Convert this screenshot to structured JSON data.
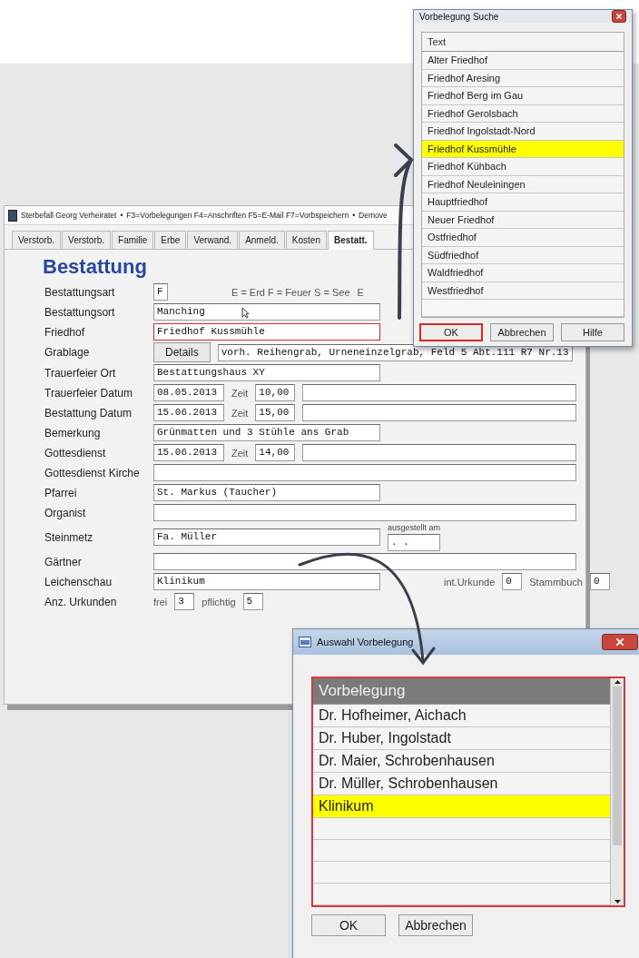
{
  "main_window": {
    "title": "Sterbefall Georg Verheiratet",
    "title_parts": [
      "•",
      "F3=Vorbelegungen F4=Anschriften F5=E-Mail F7=Vorbspeichern",
      "•",
      "Demove"
    ],
    "tabs": [
      {
        "label": "Verstorb.",
        "selected": false
      },
      {
        "label": "Verstorb.",
        "selected": false
      },
      {
        "label": "Familie",
        "selected": false
      },
      {
        "label": "Erbe",
        "selected": false
      },
      {
        "label": "Verwand.",
        "selected": false
      },
      {
        "label": "Anmeld.",
        "selected": false
      },
      {
        "label": "Kosten",
        "selected": false
      },
      {
        "label": "Bestatt.",
        "selected": true
      }
    ],
    "heading": "Bestattung",
    "rows": [
      {
        "label": "Bestattungsart",
        "items": [
          {
            "kind": "code",
            "value": "F"
          },
          {
            "kind": "note",
            "text": "E = Erd  F = Feuer  S = See"
          },
          {
            "kind": "note",
            "text": "E"
          }
        ]
      },
      {
        "label": "Bestattungsort",
        "items": [
          {
            "kind": "field",
            "value": "Manching",
            "mouse_pointer": true
          }
        ]
      },
      {
        "label": "Friedhof",
        "items": [
          {
            "kind": "field",
            "value": "Friedhof Kussmühle",
            "highlighted": true
          }
        ]
      },
      {
        "label": "Grablage",
        "items": [
          {
            "kind": "button",
            "text": "Details"
          },
          {
            "kind": "field",
            "value": "vorh. Reihengrab, Urneneinzelgrab, Feld 5 Abt.111 R7 Nr.13"
          }
        ]
      },
      {
        "label": "Trauerfeier  Ort",
        "items": [
          {
            "kind": "field",
            "value": "Bestattungshaus XY"
          }
        ]
      },
      {
        "label": "Trauerfeier Datum",
        "items": [
          {
            "kind": "date",
            "value": "08.05.2013"
          },
          {
            "kind": "note",
            "text": "Zeit"
          },
          {
            "kind": "time",
            "value": "10,00"
          },
          {
            "kind": "blank"
          }
        ]
      },
      {
        "label": "Bestattung Datum",
        "items": [
          {
            "kind": "date",
            "value": "15.06.2013"
          },
          {
            "kind": "note",
            "text": "Zeit"
          },
          {
            "kind": "time",
            "value": "15,00"
          },
          {
            "kind": "blank"
          }
        ]
      },
      {
        "label": "Bemerkung",
        "items": [
          {
            "kind": "field",
            "value": "Grünmatten und 3 Stühle ans Grab"
          }
        ]
      },
      {
        "label": "Gottesdienst",
        "items": [
          {
            "kind": "date",
            "value": "15.06.2013"
          },
          {
            "kind": "note",
            "text": "Zeit"
          },
          {
            "kind": "time",
            "value": "14,00"
          },
          {
            "kind": "blank"
          }
        ]
      },
      {
        "label": "Gottesdienst Kirche",
        "items": [
          {
            "kind": "blank"
          }
        ]
      },
      {
        "label": "Pfarrei",
        "items": [
          {
            "kind": "field",
            "value": "St. Markus (Taucher)"
          }
        ]
      },
      {
        "label": "Organist",
        "items": [
          {
            "kind": "blank"
          }
        ]
      },
      {
        "label": "Steinmetz",
        "items": [
          {
            "kind": "field",
            "value": "Fa. Müller"
          },
          {
            "kind": "captioned",
            "caption": "ausgestellt am",
            "value": ".  ."
          }
        ]
      },
      {
        "label": "Gärtner",
        "items": [
          {
            "kind": "blank"
          }
        ]
      },
      {
        "label": "Leichenschau",
        "items": [
          {
            "kind": "field",
            "value": "Klinikum"
          },
          {
            "kind": "note",
            "text": "int.Urkunde"
          },
          {
            "kind": "number",
            "value": "0"
          },
          {
            "kind": "note",
            "text": "Stammbuch"
          },
          {
            "kind": "number",
            "value": "0"
          }
        ]
      },
      {
        "label": "Anz. Urkunden",
        "items": [
          {
            "kind": "note",
            "text": "frei"
          },
          {
            "kind": "number",
            "value": "3"
          },
          {
            "kind": "note",
            "text": "pflichtig"
          },
          {
            "kind": "number",
            "value": "5"
          }
        ]
      }
    ]
  },
  "search_dialog": {
    "title": "Vorbelegung Suche",
    "column": "Text",
    "items": [
      {
        "label": "Alter Friedhof",
        "selected": false
      },
      {
        "label": "Friedhof Aresing",
        "selected": false
      },
      {
        "label": "Friedhof Berg im Gau",
        "selected": false
      },
      {
        "label": "Friedhof Gerolsbach",
        "selected": false
      },
      {
        "label": "Friedhof Ingolstadt-Nord",
        "selected": false
      },
      {
        "label": "Friedhof Kussmühle",
        "selected": true
      },
      {
        "label": "Friedhof Kühbach",
        "selected": false
      },
      {
        "label": "Friedhof Neuleiningen",
        "selected": false
      },
      {
        "label": "Hauptfriedhof",
        "selected": false
      },
      {
        "label": "Neuer Friedhof",
        "selected": false
      },
      {
        "label": "Ostfriedhof",
        "selected": false
      },
      {
        "label": "Südfriedhof",
        "selected": false
      },
      {
        "label": "Waldfriedhof",
        "selected": false
      },
      {
        "label": "Westfriedhof",
        "selected": false
      }
    ],
    "buttons": [
      {
        "label": "OK",
        "highlighted": true
      },
      {
        "label": "Abbrechen",
        "highlighted": false
      },
      {
        "label": "Hilfe",
        "highlighted": false
      }
    ]
  },
  "choice_dialog": {
    "title": "Auswahl Vorbelegung",
    "column": "Vorbelegung",
    "items": [
      {
        "label": "Dr. Hofheimer, Aichach",
        "selected": false
      },
      {
        "label": "Dr. Huber, Ingolstadt",
        "selected": false
      },
      {
        "label": "Dr. Maier, Schrobenhausen",
        "selected": false
      },
      {
        "label": "Dr. Müller, Schrobenhausen",
        "selected": false
      },
      {
        "label": "Klinikum",
        "selected": true
      }
    ],
    "buttons": [
      {
        "label": "OK"
      },
      {
        "label": "Abbrechen"
      }
    ]
  }
}
